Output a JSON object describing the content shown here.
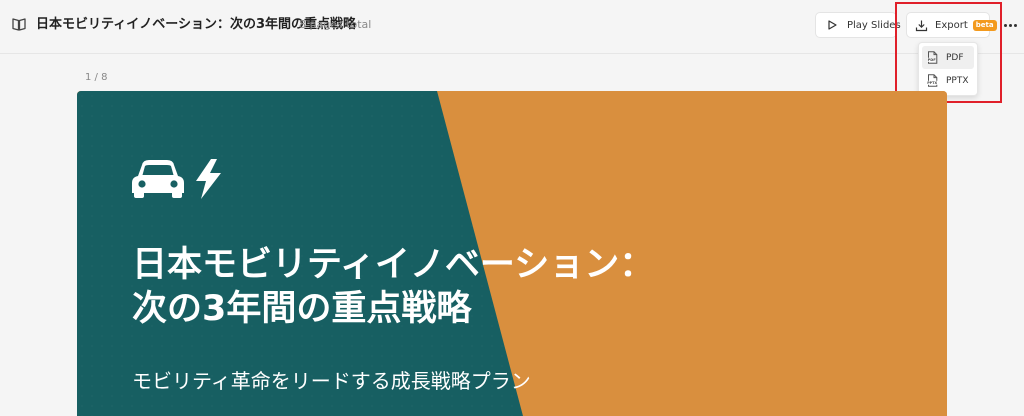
{
  "header": {
    "title": "日本モビリティイノベーション：次の3年間の重点戦略",
    "pages_total": "8 pages total",
    "book_icon": "book-open-icon"
  },
  "toolbar": {
    "play_label": "Play Slides",
    "play_icon": "play-icon",
    "export_label": "Export",
    "export_icon": "download-icon",
    "beta_badge": "beta",
    "more_icon": "more-horizontal-icon"
  },
  "export_menu": {
    "items": [
      {
        "label": "PDF",
        "icon": "pdf-file-icon",
        "active": true
      },
      {
        "label": "PPTX",
        "icon": "pptx-file-icon",
        "active": false
      }
    ]
  },
  "page_counter": "1 / 8",
  "slide": {
    "icons": [
      "car-icon",
      "lightning-bolt-icon"
    ],
    "title_line1": "日本モビリティイノベーション：",
    "title_line2": "次の3年間の重点戦略",
    "subtitle": "モビリティ革命をリードする成長戦略プラン",
    "colors": {
      "teal": "#175f62",
      "orange": "#d98f3e",
      "text": "#ffffff"
    }
  },
  "colors": {
    "highlight_box": "#e0202a",
    "beta_badge": "#f39a1e"
  }
}
